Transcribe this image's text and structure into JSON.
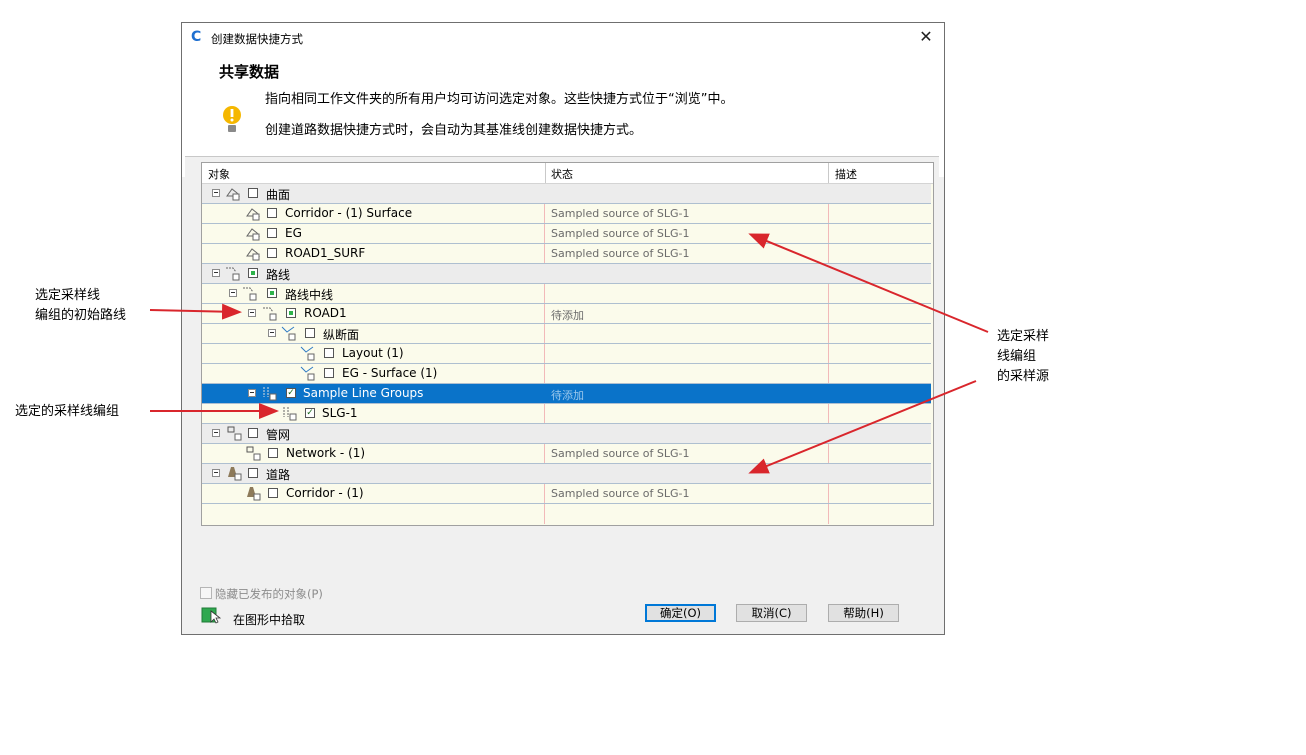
{
  "window": {
    "title": "创建数据快捷方式",
    "close_glyph": "✕"
  },
  "header": {
    "heading": "共享数据",
    "info_line1": "指向相同工作文件夹的所有用户均可访问选定对象。这些快捷方式位于“浏览”中。",
    "info_line2": "创建道路数据快捷方式时，会自动为其基准线创建数据快捷方式。",
    "info_icon": "warning-bulb-icon"
  },
  "grid": {
    "columns": [
      "对象",
      "状态",
      "描述"
    ],
    "rows": [
      {
        "name": "曲面",
        "status": "",
        "type": "group",
        "check": "none"
      },
      {
        "name": "Corridor - (1) Surface",
        "status": "Sampled source of SLG-1",
        "check": "none"
      },
      {
        "name": "EG",
        "status": "Sampled source of SLG-1",
        "check": "none"
      },
      {
        "name": "ROAD1_SURF",
        "status": "Sampled source of SLG-1",
        "check": "none"
      },
      {
        "name": "路线",
        "status": "",
        "type": "group",
        "check": "partial"
      },
      {
        "name": "路线中线",
        "status": "",
        "check": "partial"
      },
      {
        "name": "ROAD1",
        "status": "待添加",
        "check": "partial"
      },
      {
        "name": "纵断面",
        "status": "",
        "check": "none"
      },
      {
        "name": "Layout (1)",
        "status": "",
        "check": "none"
      },
      {
        "name": "EG - Surface (1)",
        "status": "",
        "check": "none"
      },
      {
        "name": "Sample Line Groups",
        "status": "待添加",
        "type": "selected",
        "check": "checked"
      },
      {
        "name": "SLG-1",
        "status": "",
        "check": "checked"
      },
      {
        "name": "管网",
        "status": "",
        "type": "group",
        "check": "none"
      },
      {
        "name": "Network - (1)",
        "status": "Sampled source of SLG-1",
        "check": "none"
      },
      {
        "name": "道路",
        "status": "",
        "type": "group",
        "check": "none"
      },
      {
        "name": "Corridor - (1)",
        "status": "Sampled source of SLG-1",
        "check": "none"
      }
    ]
  },
  "footer": {
    "hide_published_label": "隐藏已发布的对象(P)",
    "pick_label": "在图形中拾取",
    "ok_label": "确定(O)",
    "cancel_label": "取消(C)",
    "help_label": "帮助(H)"
  },
  "annotations": {
    "left_top_line1": "选定采样线",
    "left_top_line2": "编组的初始路线",
    "left_bottom": "选定的采样线编组",
    "right_line1": "选定采样",
    "right_line2": "线编组",
    "right_line3": "的采样源",
    "arrow_color": "#d9262c"
  },
  "colors": {
    "selection": "#0a73c9",
    "grid_bg": "#fbfbeb",
    "group_bg": "#ececec"
  }
}
